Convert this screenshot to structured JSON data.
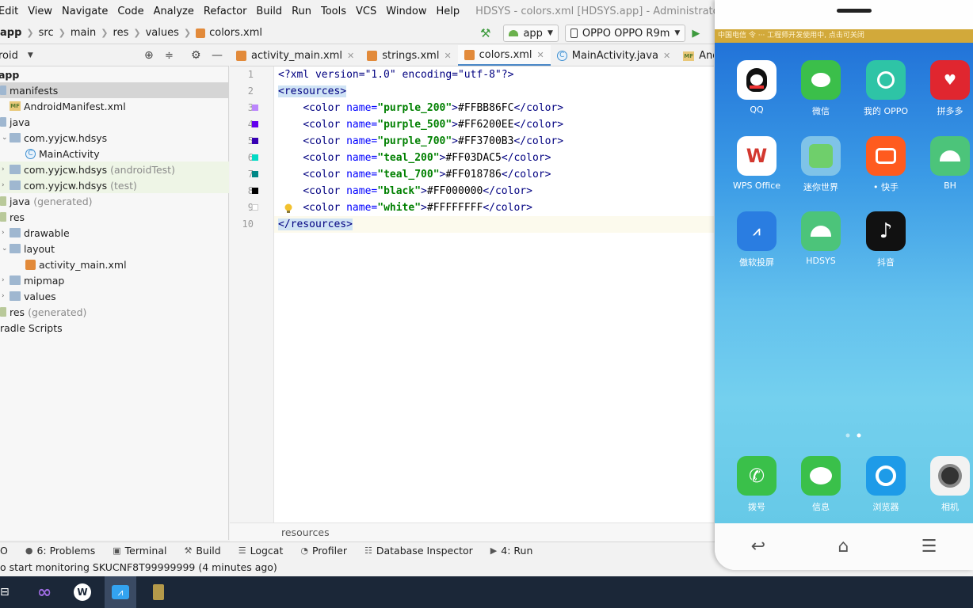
{
  "menu": [
    "Edit",
    "View",
    "Navigate",
    "Code",
    "Analyze",
    "Refactor",
    "Build",
    "Run",
    "Tools",
    "VCS",
    "Window",
    "Help"
  ],
  "window_title": "HDSYS - colors.xml [HDSYS.app] - Administrator",
  "breadcrumbs": [
    "app",
    "src",
    "main",
    "res",
    "values",
    "colors.xml"
  ],
  "toolbar": {
    "module": "app",
    "device": "OPPO OPPO R9m"
  },
  "project": {
    "view": "roid",
    "root": "app",
    "items": [
      {
        "label": "manifests",
        "extra": ""
      },
      {
        "label": "AndroidManifest.xml",
        "extra": ""
      },
      {
        "label": "java",
        "extra": ""
      },
      {
        "label": "com.yyjcw.hdsys",
        "extra": ""
      },
      {
        "label": "MainActivity",
        "extra": ""
      },
      {
        "label": "com.yyjcw.hdsys",
        "extra": "(androidTest)"
      },
      {
        "label": "com.yyjcw.hdsys",
        "extra": "(test)"
      },
      {
        "label": "java",
        "extra": "(generated)"
      },
      {
        "label": "res",
        "extra": ""
      },
      {
        "label": "drawable",
        "extra": ""
      },
      {
        "label": "layout",
        "extra": ""
      },
      {
        "label": "activity_main.xml",
        "extra": ""
      },
      {
        "label": "mipmap",
        "extra": ""
      },
      {
        "label": "values",
        "extra": ""
      },
      {
        "label": "res",
        "extra": "(generated)"
      },
      {
        "label": "radle Scripts",
        "extra": ""
      }
    ]
  },
  "tabs": [
    "activity_main.xml",
    "strings.xml",
    "colors.xml",
    "MainActivity.java",
    "AndroidMar"
  ],
  "active_tab": "colors.xml",
  "editor": {
    "line_numbers": [
      "1",
      "2",
      "3",
      "4",
      "5",
      "6",
      "7",
      "8",
      "9",
      "10"
    ],
    "decl": "<?xml version=\"1.0\" encoding=\"utf-8\"?>",
    "open_tag": "<resources>",
    "close_tag": "</resources>",
    "colors": [
      {
        "name": "\"purple_200\"",
        "value": "#FFBB86FC",
        "swatch": "#BB86FC"
      },
      {
        "name": "\"purple_500\"",
        "value": "#FF6200EE",
        "swatch": "#6200EE"
      },
      {
        "name": "\"purple_700\"",
        "value": "#FF3700B3",
        "swatch": "#3700B3"
      },
      {
        "name": "\"teal_200\"",
        "value": "#FF03DAC5",
        "swatch": "#03DAC5"
      },
      {
        "name": "\"teal_700\"",
        "value": "#FF018786",
        "swatch": "#018786"
      },
      {
        "name": "\"black\"",
        "value": "#FF000000",
        "swatch": "#000000"
      },
      {
        "name": "\"white\"",
        "value": "#FFFFFFFF",
        "swatch": "#FFFFFF"
      }
    ],
    "breadcrumb": "resources"
  },
  "tool_windows": [
    {
      "label": "O",
      "icon": ""
    },
    {
      "label": "6: Problems",
      "icon": "warning-icon"
    },
    {
      "label": "Terminal",
      "icon": "terminal-icon"
    },
    {
      "label": "Build",
      "icon": "hammer-icon"
    },
    {
      "label": "Logcat",
      "icon": "logcat-icon"
    },
    {
      "label": "Profiler",
      "icon": "profiler-icon"
    },
    {
      "label": "Database Inspector",
      "icon": "database-icon"
    },
    {
      "label": "4: Run",
      "icon": "run-icon"
    }
  ],
  "status": "o start monitoring SKUCNF8T99999999 (4 minutes ago)",
  "phone": {
    "status_text": "中国电信 令 ··· 工程师开发使用中, 点击可关闭",
    "apps": [
      {
        "label": "QQ",
        "icon": "qq-icon",
        "bg": "#ffffff",
        "fg": "#111111",
        "glyph": "Q"
      },
      {
        "label": "微信",
        "icon": "wechat-icon",
        "bg": "#3bbf4a",
        "fg": "#ffffff",
        "glyph": "W"
      },
      {
        "label": "我的 OPPO",
        "icon": "oppo-icon",
        "bg": "#2ec4a6",
        "fg": "#ffffff",
        "glyph": "O"
      },
      {
        "label": "拼多多",
        "icon": "pinduoduo-icon",
        "bg": "#e0262f",
        "fg": "#ffffff",
        "glyph": "P"
      },
      {
        "label": "WPS Office",
        "icon": "wps-icon",
        "bg": "#ffffff",
        "fg": "#d3382f",
        "glyph": "W"
      },
      {
        "label": "迷你世界",
        "icon": "mini-world-icon",
        "bg": "#7fc3e8",
        "fg": "#ffffff",
        "glyph": "M"
      },
      {
        "label": "• 快手",
        "icon": "kuaishou-icon",
        "bg": "#ff5b1f",
        "fg": "#ffffff",
        "glyph": "K"
      },
      {
        "label": "BH",
        "icon": "android-icon",
        "bg": "#4cc47a",
        "fg": "#ffffff",
        "glyph": "A"
      },
      {
        "label": "傲软投屏",
        "icon": "apowermirror-icon",
        "bg": "#2a7de1",
        "fg": "#ffffff",
        "glyph": "624"
      },
      {
        "label": "HDSYS",
        "icon": "android-icon",
        "bg": "#4cc47a",
        "fg": "#ffffff",
        "glyph": "A"
      },
      {
        "label": "抖音",
        "icon": "douyin-icon",
        "bg": "#111111",
        "fg": "#ffffff",
        "glyph": "♪"
      },
      {
        "label": "拨号",
        "icon": "phone-icon",
        "bg": "#3ac04a",
        "fg": "#ffffff",
        "glyph": "☎"
      },
      {
        "label": "信息",
        "icon": "message-icon",
        "bg": "#3ac04a",
        "fg": "#ffffff",
        "glyph": "…"
      },
      {
        "label": "浏览器",
        "icon": "browser-icon",
        "bg": "#1e9be8",
        "fg": "#ffffff",
        "glyph": "◎"
      },
      {
        "label": "相机",
        "icon": "camera-icon",
        "bg": "#f2f2f2",
        "fg": "#222222",
        "glyph": "◉"
      }
    ]
  },
  "colors": {
    "accent": "#4a88c7",
    "selection": "#d5d5d5",
    "taskbar": "#1b2738"
  }
}
